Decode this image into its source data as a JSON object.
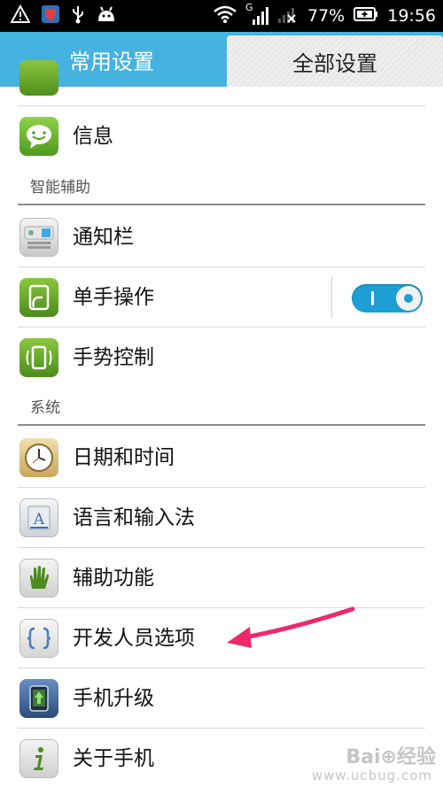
{
  "status_bar": {
    "network_type": "G",
    "battery_percent": "77%",
    "time": "19:56"
  },
  "tabs": {
    "common": "常用设置",
    "all": "全部设置"
  },
  "sections": {
    "smart_assist": "智能辅助",
    "system": "系统"
  },
  "items": {
    "messages": "信息",
    "notification_bar": "通知栏",
    "one_hand": "单手操作",
    "gesture": "手势控制",
    "date_time": "日期和时间",
    "language": "语言和输入法",
    "accessibility": "辅助功能",
    "developer": "开发人员选项",
    "upgrade": "手机升级",
    "about": "关于手机"
  },
  "toggle": {
    "one_hand_on": true
  },
  "watermark": {
    "logo": "Bai⊕经验",
    "url": "www.ucbug.com"
  },
  "colors": {
    "tab_bar": "#45b2e0",
    "toggle_on": "#1d9fd6",
    "arrow": "#ec2a6a"
  }
}
